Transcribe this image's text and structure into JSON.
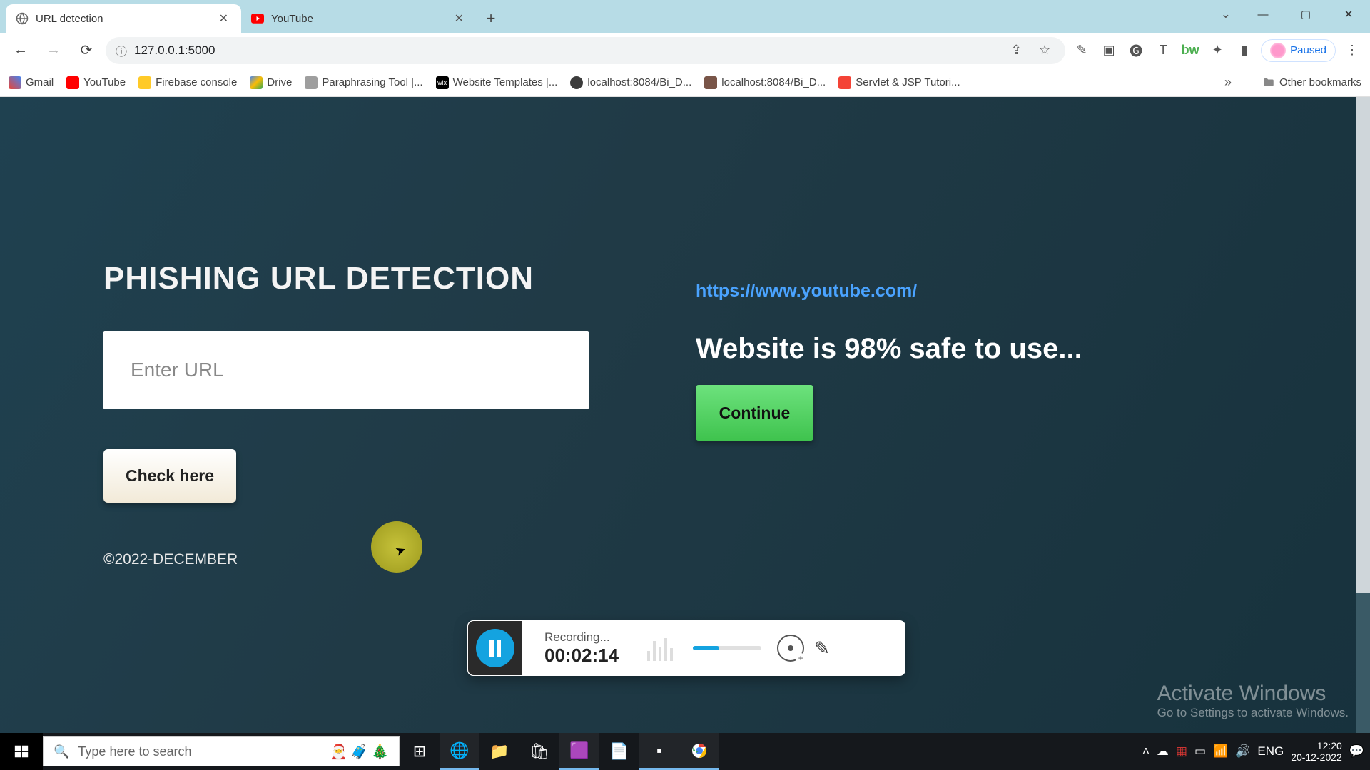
{
  "browser": {
    "tabs": [
      {
        "title": "URL detection",
        "active": true
      },
      {
        "title": "YouTube",
        "active": false
      }
    ],
    "address_url": "127.0.0.1:5000",
    "paused_label": "Paused"
  },
  "bookmarks": [
    {
      "label": "Gmail",
      "icon": "gmail"
    },
    {
      "label": "YouTube",
      "icon": "yt"
    },
    {
      "label": "Firebase console",
      "icon": "fb"
    },
    {
      "label": "Drive",
      "icon": "drive"
    },
    {
      "label": "Paraphrasing Tool |...",
      "icon": "para"
    },
    {
      "label": "Website Templates |...",
      "icon": "wix"
    },
    {
      "label": "localhost:8084/Bi_D...",
      "icon": "local"
    },
    {
      "label": "localhost:8084/Bi_D...",
      "icon": "local"
    },
    {
      "label": "Servlet & JSP Tutori...",
      "icon": "servlet"
    }
  ],
  "other_bookmarks_label": "Other bookmarks",
  "page": {
    "heading": "PHISHING URL DETECTION",
    "input_placeholder": "Enter URL",
    "check_label": "Check here",
    "footer": "©2022-DECEMBER",
    "checked_url": "https://www.youtube.com/",
    "safe_message": "Website is 98% safe to use...",
    "continue_label": "Continue"
  },
  "recorder": {
    "status": "Recording...",
    "time": "00:02:14"
  },
  "watermark": {
    "title": "Activate Windows",
    "sub": "Go to Settings to activate Windows."
  },
  "taskbar": {
    "search_placeholder": "Type here to search",
    "lang": "ENG",
    "time": "12:20",
    "date": "20-12-2022"
  }
}
